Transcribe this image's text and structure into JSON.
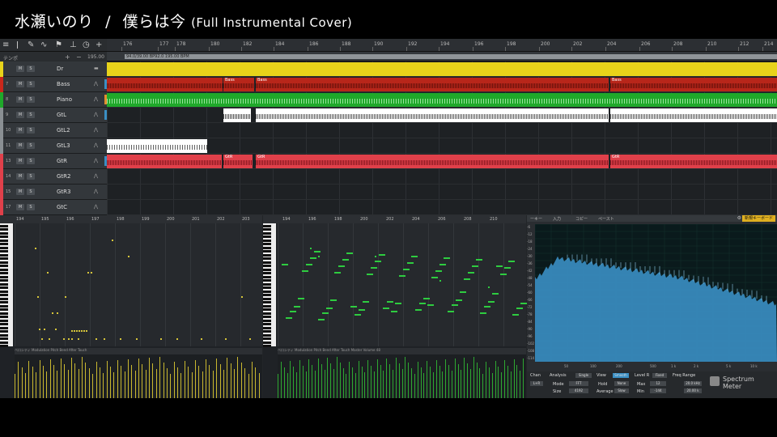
{
  "title": {
    "artist": "水瀬いのり",
    "separator": "/",
    "song": "僕らは今",
    "note": "(Full Instrumental Cover)"
  },
  "toolbar": {
    "tempo_label": "テンポ",
    "tempo_value": "195.00"
  },
  "ruler": {
    "bars": [
      "176",
      "177",
      "178",
      "180",
      "182",
      "184",
      "186",
      "188",
      "190",
      "192",
      "194",
      "196",
      "198",
      "200",
      "202",
      "204",
      "206",
      "208",
      "210",
      "212",
      "214"
    ]
  },
  "tempo_lane": {
    "marker": "94.0/39.00 BP92.0 195.00 BPM"
  },
  "tracks": [
    {
      "num": "",
      "name": "Dr",
      "color": "#e8d31a"
    },
    {
      "num": "7",
      "name": "Bass",
      "color": "#c9271b"
    },
    {
      "num": "8",
      "name": "Piano",
      "color": "#1fa82a"
    },
    {
      "num": "9",
      "name": "GtL",
      "color": "#8a8f93"
    },
    {
      "num": "10",
      "name": "GtL2",
      "color": "#8a8f93"
    },
    {
      "num": "11",
      "name": "GtL3",
      "color": "#8a8f93"
    },
    {
      "num": "13",
      "name": "GtR",
      "color": "#e0404a"
    },
    {
      "num": "14",
      "name": "GtR2",
      "color": "#e0404a"
    },
    {
      "num": "15",
      "name": "GtR3",
      "color": "#e0404a"
    },
    {
      "num": "17",
      "name": "GtC",
      "color": "#e0404a"
    }
  ],
  "buttons": {
    "mute": "M",
    "solo": "S"
  },
  "clip_labels": {
    "bass": "Bass",
    "gtr": "GtR"
  },
  "editor1": {
    "bars": [
      "194",
      "195",
      "196",
      "197",
      "198",
      "199",
      "200",
      "201",
      "202",
      "203"
    ],
    "vel_tabs": "ベロシティ  Modulation  Pitch Bend  After Touch"
  },
  "editor2": {
    "bars": [
      "194",
      "196",
      "198",
      "200",
      "202",
      "204",
      "206",
      "208",
      "210"
    ],
    "vel_tabs": "ベロシティ  Modulation  Pitch Bend  After Touch  Master Volume 48"
  },
  "spectrum": {
    "top_tabs": [
      "ーキー",
      "入力",
      "コピー",
      "ペースト"
    ],
    "top_right": "新規キーボード",
    "y_labels": [
      "-6",
      "-12",
      "-18",
      "-24",
      "-30",
      "-36",
      "-42",
      "-48",
      "-54",
      "-60",
      "-66",
      "-72",
      "-78",
      "-84",
      "-90",
      "-96",
      "-102",
      "-108",
      "-114"
    ],
    "x_labels": [
      "50",
      "100",
      "200",
      "500",
      "1 k",
      "2 k",
      "5 k",
      "10 k"
    ],
    "controls": {
      "chan": "Chan",
      "chan_val": "L+R",
      "analysis": "Analysis",
      "single": "Single",
      "mode_lbl": "Mode",
      "mode_val": "FFT",
      "size_lbl": "Size",
      "size_val": "4192",
      "view": "View",
      "smooth": "Smooth",
      "hold_lbl": "Hold",
      "hold_val": "None",
      "avg_lbl": "Average",
      "avg_val": "Slow",
      "level": "Level R",
      "fixed": "Fixed",
      "max_lbl": "Max",
      "max_val": "12",
      "min_lbl": "Min",
      "min_val": "-144",
      "freq": "Freq Range",
      "fmax": "20.0 kHz",
      "fmin": "20.00 k",
      "brand": "Spectrum Meter"
    }
  },
  "colors": {
    "yellow": "#e8d31a",
    "red": "#c9271b",
    "green": "#1fa82a",
    "gtr": "#e0404a",
    "spec": "#3a8fc4"
  }
}
